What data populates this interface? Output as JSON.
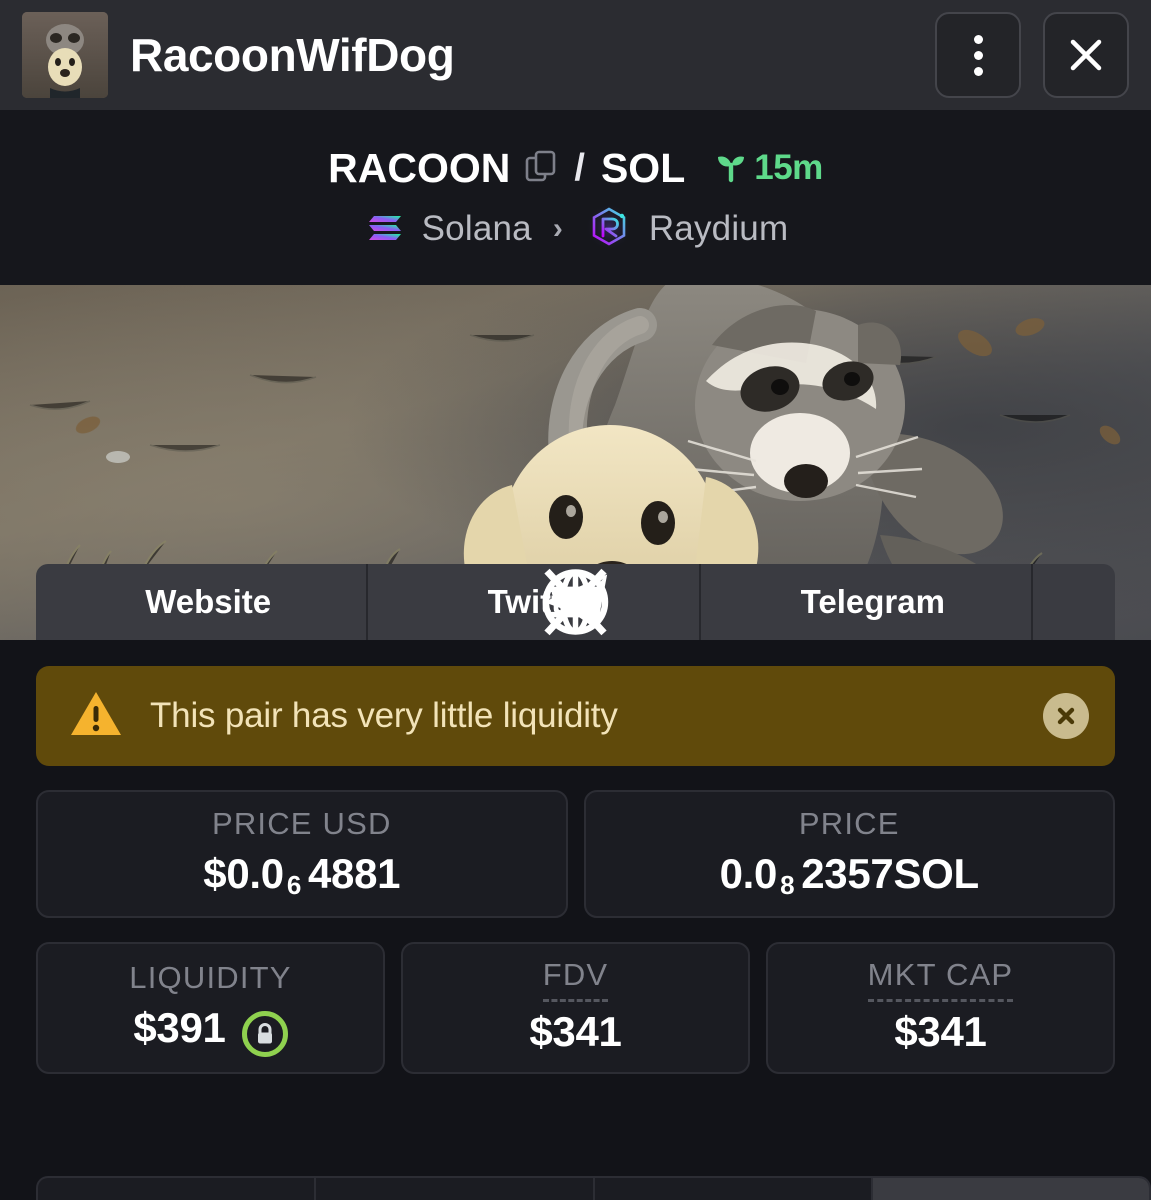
{
  "titlebar": {
    "title": "RacoonWifDog",
    "avatar_alt": "raccoon-hugging-dog-thumbnail",
    "menu_icon": "kebab-menu-icon",
    "close_icon": "close-icon"
  },
  "pair": {
    "base_symbol": "RACOON",
    "quote_symbol": "SOL",
    "separator": "/",
    "copy_icon": "copy-icon",
    "age_icon": "seedling-icon",
    "age": "15m",
    "age_color": "#5ed98a",
    "chain": "Solana",
    "chain_icon": "solana-logo-icon",
    "arrow": "›",
    "dex": "Raydium",
    "dex_icon": "raydium-logo-icon"
  },
  "banner": {
    "alt": "raccoon lying on ground hugging a dog's head"
  },
  "social": {
    "buttons": [
      {
        "label": "Website",
        "icon": "globe-icon"
      },
      {
        "label": "Twitter",
        "icon": "x-twitter-icon"
      },
      {
        "label": "Telegram",
        "icon": "telegram-paper-plane-icon"
      }
    ],
    "more_icon": "chevron-down-icon"
  },
  "warning": {
    "icon": "warning-triangle-icon",
    "text": "This pair has very little liquidity",
    "close_icon": "close-circle-icon",
    "bg_color": "#604a0b",
    "text_color": "#f2e3b8"
  },
  "stats_primary": [
    {
      "label": "PRICE USD",
      "prefix": "$0.0",
      "subscript": "6",
      "suffix": "4881",
      "unit": ""
    },
    {
      "label": "PRICE",
      "prefix": "0.0",
      "subscript": "8",
      "suffix": "2357",
      "unit": " SOL"
    }
  ],
  "stats_secondary": [
    {
      "label": "LIQUIDITY",
      "value": "$391",
      "dashed": false,
      "badge": "lock-icon",
      "badge_color": "#8fd14f"
    },
    {
      "label": "FDV",
      "value": "$341",
      "dashed": true,
      "badge": "",
      "badge_color": ""
    },
    {
      "label": "MKT CAP",
      "value": "$341",
      "dashed": true,
      "badge": "",
      "badge_color": ""
    }
  ],
  "bottom_segments": [
    {
      "label": "",
      "active": false
    },
    {
      "label": "",
      "active": false
    },
    {
      "label": "",
      "active": false
    },
    {
      "label": "",
      "active": true
    }
  ]
}
